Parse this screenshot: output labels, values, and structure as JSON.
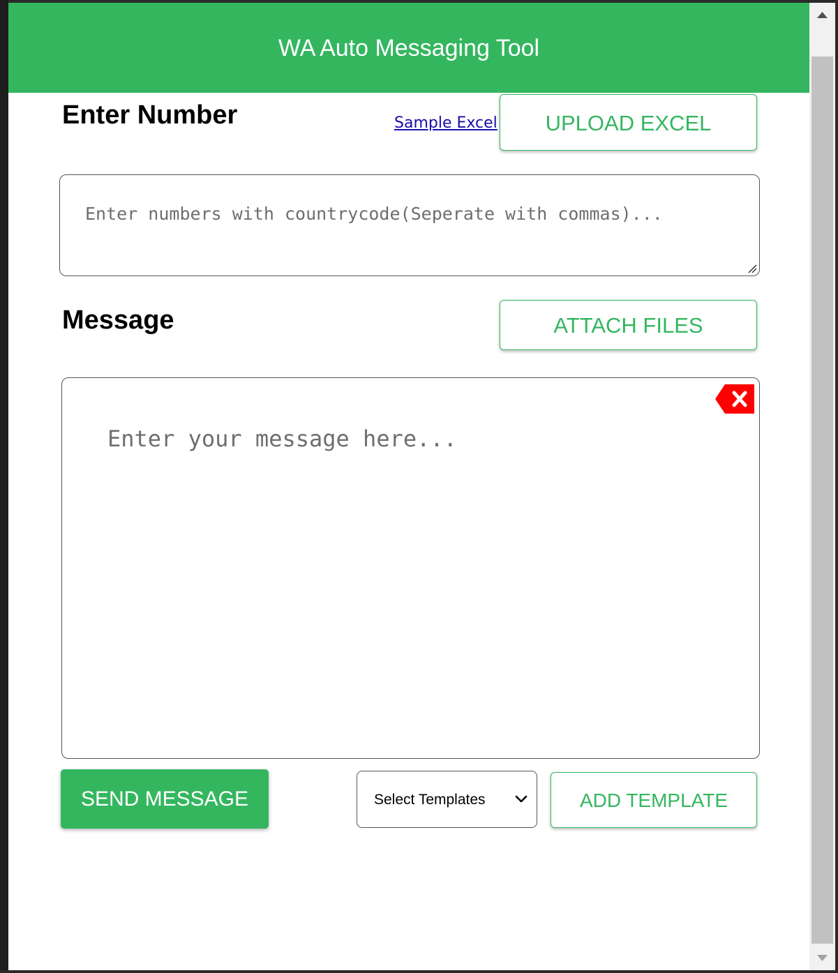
{
  "header": {
    "title": "WA Auto Messaging Tool"
  },
  "numbers": {
    "label": "Enter Number",
    "sample_link": "Sample Excel",
    "upload_button": "UPLOAD EXCEL",
    "placeholder": "Enter numbers with countrycode(Seperate with commas)..."
  },
  "message": {
    "label": "Message",
    "attach_button": "ATTACH FILES",
    "placeholder": "Enter your message here...",
    "clear_icon": "close-x-icon"
  },
  "actions": {
    "send_button": "SEND MESSAGE",
    "template_select": "Select Templates",
    "add_template_button": "ADD TEMPLATE"
  },
  "colors": {
    "accent": "#34b65f",
    "danger": "#ff0000"
  }
}
